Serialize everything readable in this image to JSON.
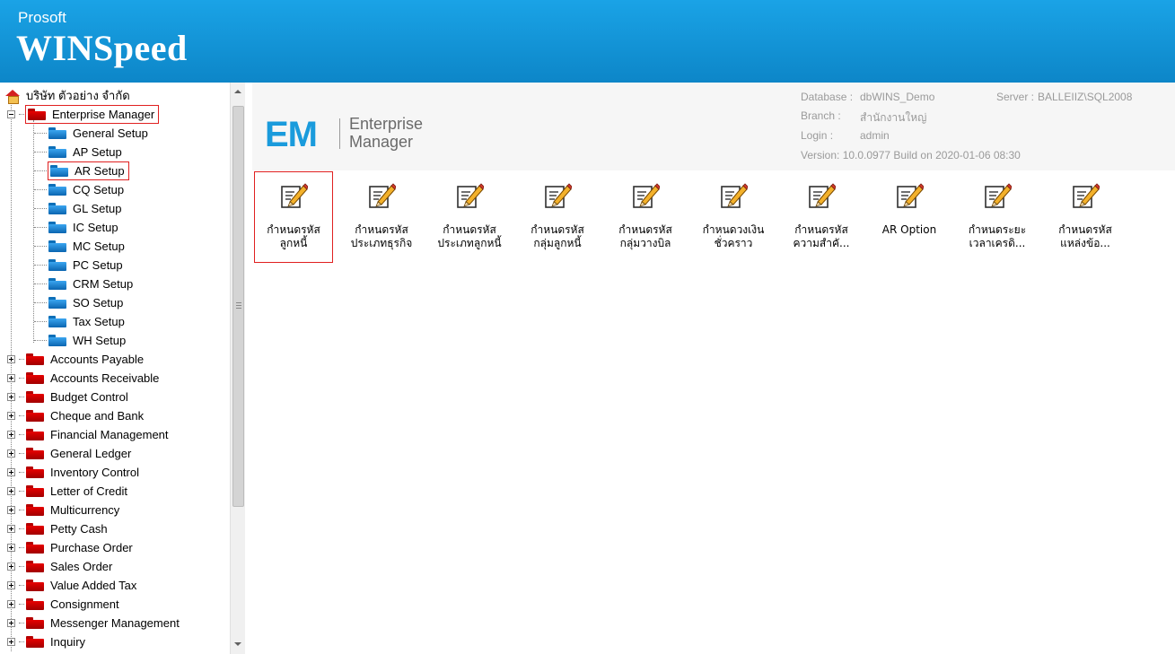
{
  "header": {
    "brand_top": "Prosoft",
    "brand_main": "WINSpeed"
  },
  "tree": {
    "root": "บริษัท ตัวอย่าง จำกัด",
    "expanded": {
      "label": "Enterprise Manager"
    },
    "children": [
      "General Setup",
      "AP Setup",
      "AR Setup",
      "CQ Setup",
      "GL Setup",
      "IC Setup",
      "MC Setup",
      "PC Setup",
      "CRM Setup",
      "SO Setup",
      "Tax Setup",
      "WH Setup"
    ],
    "modules": [
      "Accounts Payable",
      "Accounts Receivable",
      "Budget Control",
      "Cheque and Bank",
      "Financial Management",
      "General Ledger",
      "Inventory Control",
      "Letter of Credit",
      "Multicurrency",
      "Petty Cash",
      "Purchase Order",
      "Sales Order",
      "Value Added Tax",
      "Consignment",
      "Messenger Management",
      "Inquiry"
    ]
  },
  "banner": {
    "logo": "EM",
    "line1": "Enterprise",
    "line2": "Manager",
    "database_label": "Database :",
    "database_value": "dbWINS_Demo",
    "server_label": "Server :",
    "server_value": "BALLEIIZ\\SQL2008",
    "branch_label": "Branch :",
    "branch_value": "สำนักงานใหญ่",
    "login_label": "Login :",
    "login_value": "admin",
    "version": "Version: 10.0.0977  Build on 2020-01-06 08:30"
  },
  "tiles": [
    {
      "l1": "กำหนดรหัส",
      "l2": "ลูกหนี้"
    },
    {
      "l1": "กำหนดรหัส",
      "l2": "ประเภทธุรกิจ"
    },
    {
      "l1": "กำหนดรหัส",
      "l2": "ประเภทลูกหนี้"
    },
    {
      "l1": "กำหนดรหัส",
      "l2": "กลุ่มลูกหนี้"
    },
    {
      "l1": "กำหนดรหัส",
      "l2": "กลุ่มวางบิล"
    },
    {
      "l1": "กำหนดวงเงิน",
      "l2": "ชั่วคราว"
    },
    {
      "l1": "กำหนดรหัส",
      "l2": "ความสำคั..."
    },
    {
      "l1": "AR Option",
      "l2": ""
    },
    {
      "l1": "กำหนดระยะ",
      "l2": "เวลาเครดิ..."
    },
    {
      "l1": "กำหนดรหัส",
      "l2": "แหล่งข้อ..."
    }
  ],
  "colors": {
    "header": "#1aa3e6",
    "em_blue": "#1a9bdc",
    "selection": "#e02020",
    "folder_red": "#e60000",
    "folder_blue": "#3aa5f0"
  },
  "icons": {
    "tile": "edit-document-pencil-icon",
    "root": "home-icon"
  }
}
